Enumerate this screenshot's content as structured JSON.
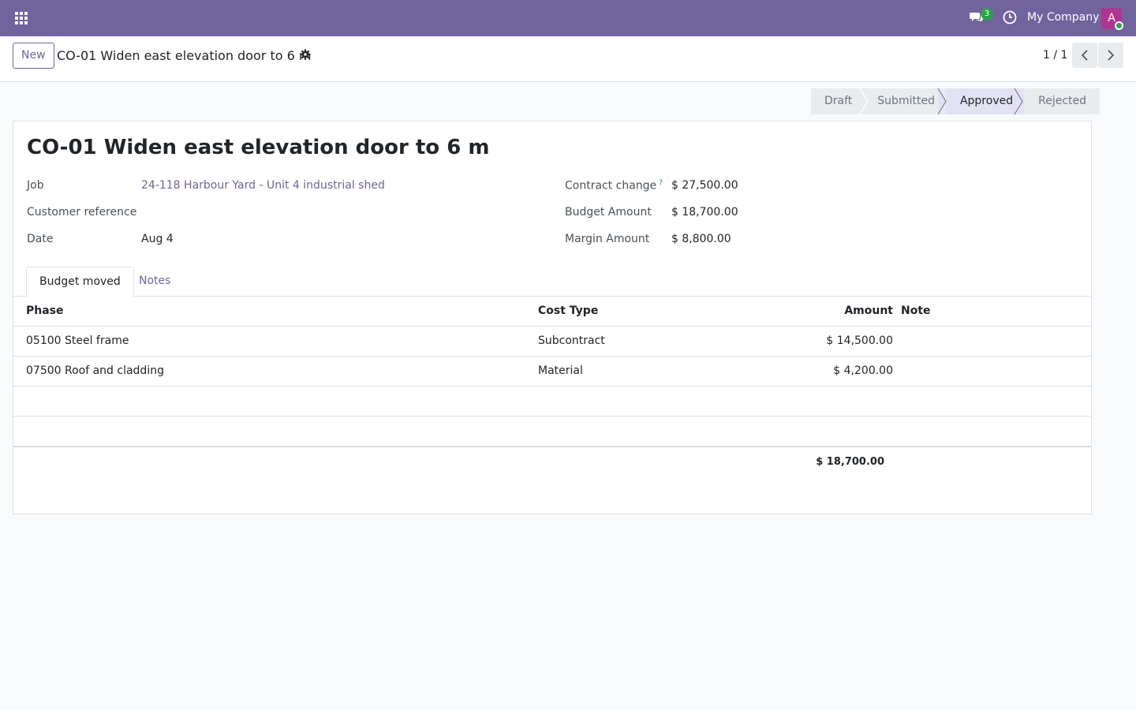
{
  "navbar": {
    "company": "My Company",
    "chat_count": "3",
    "avatar_initial": "A",
    "accent": "#71639e"
  },
  "control_panel": {
    "new_label": "New",
    "title": "CO-01 Widen east elevation door to 6 m",
    "pager": "1 / 1"
  },
  "statusbar": {
    "stages": [
      "Draft",
      "Submitted",
      "Approved",
      "Rejected"
    ],
    "active": "Approved"
  },
  "record": {
    "title": "CO-01 Widen east elevation door to 6 m",
    "fields_left": [
      {
        "label": "Job",
        "value": "24-118 Harbour Yard - Unit 4 industrial shed"
      },
      {
        "label": "Customer reference",
        "value": ""
      },
      {
        "label": "Date",
        "value": "Aug 4"
      }
    ],
    "fields_right": [
      {
        "label": "Contract change",
        "help": "?",
        "value": "$ 27,500.00"
      },
      {
        "label": "Budget Amount",
        "value": "$ 18,700.00"
      },
      {
        "label": "Margin Amount",
        "value": "$ 8,800.00"
      }
    ]
  },
  "tabs": [
    "Budget moved",
    "Notes"
  ],
  "table": {
    "headers": {
      "phase": "Phase",
      "cost_type": "Cost Type",
      "amount": "Amount",
      "note": "Note"
    },
    "rows": [
      {
        "phase": "05100 Steel frame",
        "cost_type": "Subcontract",
        "amount": "$ 14,500.00",
        "note": ""
      },
      {
        "phase": "07500 Roof and cladding",
        "cost_type": "Material",
        "amount": "$ 4,200.00",
        "note": ""
      }
    ],
    "total": "$ 18,700.00"
  }
}
